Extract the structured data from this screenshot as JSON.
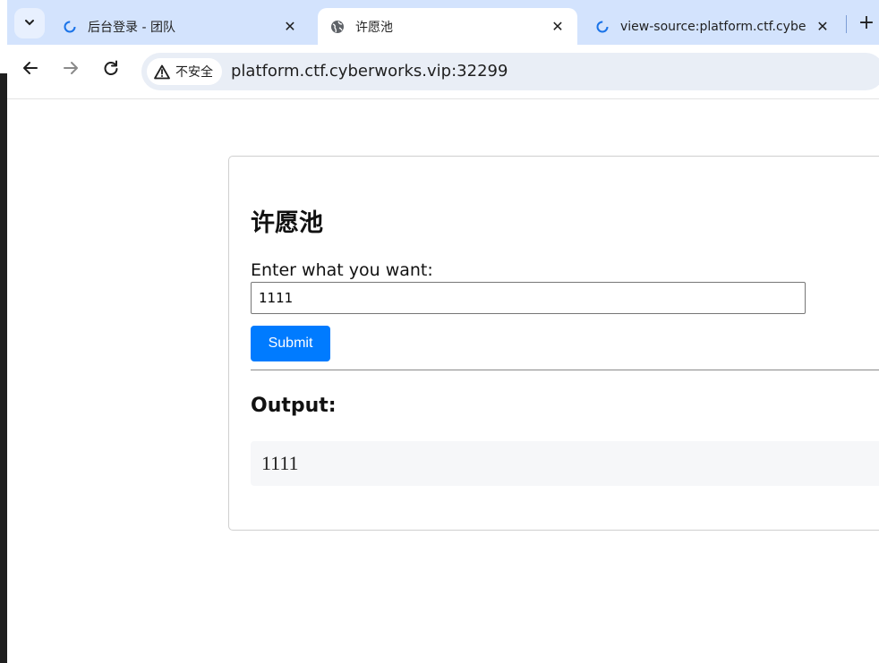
{
  "browser": {
    "tabs": [
      {
        "title": "后台登录 - 团队",
        "active": false,
        "icon": "loading-icon"
      },
      {
        "title": "许愿池",
        "active": true,
        "icon": "globe-icon"
      },
      {
        "title": "view-source:platform.ctf.cybe",
        "active": false,
        "icon": "loading-icon"
      }
    ],
    "security_label": "不安全",
    "url": "platform.ctf.cyberworks.vip:32299",
    "icons": {
      "tab_list": "chevron-down-icon",
      "back": "arrow-left-icon",
      "forward": "arrow-right-icon",
      "reload": "reload-icon",
      "security": "warning-triangle-icon",
      "new_tab": "plus-icon",
      "close": "close-icon"
    }
  },
  "page": {
    "title": "许愿池",
    "input_label": "Enter what you want:",
    "input_value": "1111",
    "submit_label": "Submit",
    "output_title": "Output:",
    "output_value": "1111"
  },
  "colors": {
    "tabstrip": "#d3e3fd",
    "omnibox": "#e9eef6",
    "submit_button": "#007bff",
    "output_box": "#f6f7f9"
  }
}
